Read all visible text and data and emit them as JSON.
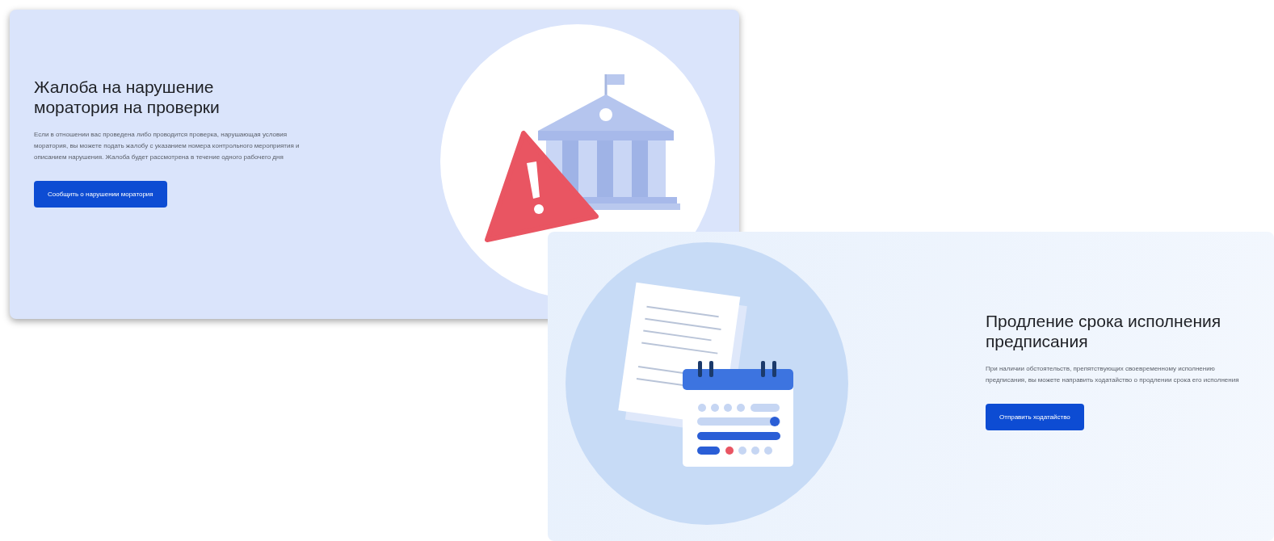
{
  "cards": [
    {
      "kind": "warning",
      "title": "Жалоба на нарушение моратория на проверки",
      "text": "Если в отношении вас проведена либо проводится проверка, нарушающая условия моратория, вы можете подать жалобу с указанием номера контрольного мероприятия и описанием нарушения. Жалоба будет рассмотрена в течение одного рабочего дня",
      "button": "Сообщить о нарушении моратория"
    },
    {
      "kind": "calendar",
      "title": "Продление срока исполнения предписания",
      "text": "При наличии обстоятельств, препятствующих своевременному исполнению предписания, вы можете направить ходатайство о продлении срока его исполнения",
      "button": "Отправить ходатайство"
    }
  ]
}
